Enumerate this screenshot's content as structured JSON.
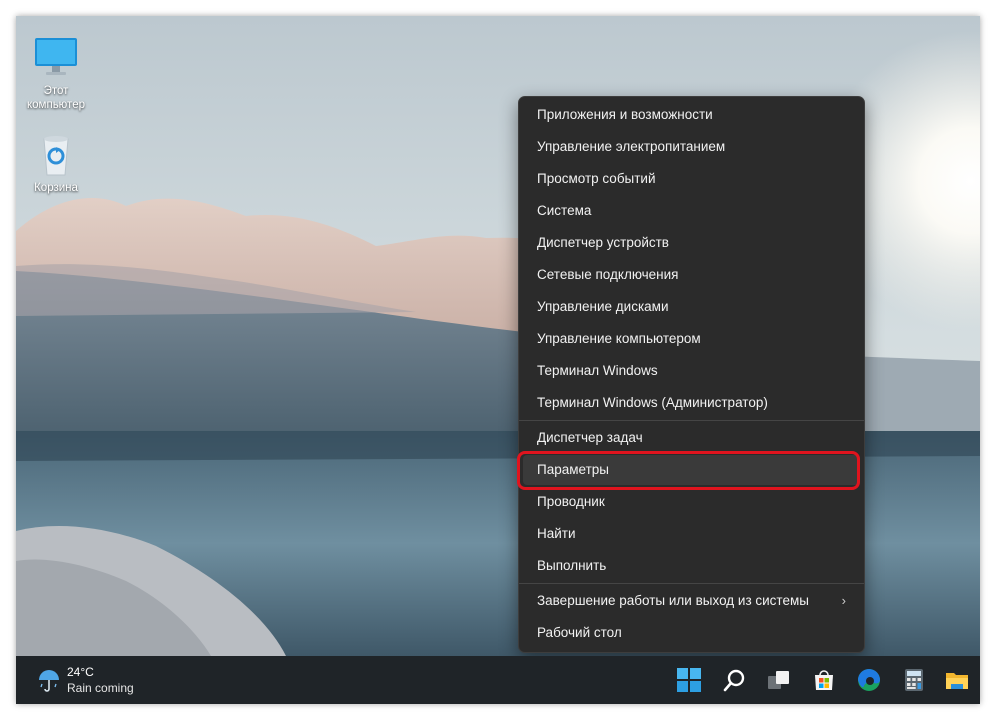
{
  "desktop": {
    "icons": [
      {
        "label": "Этот\nкомпьютер",
        "icon": "monitor-icon"
      },
      {
        "label": "Корзина",
        "icon": "recycle-bin-icon"
      }
    ]
  },
  "context_menu": {
    "items": [
      {
        "label": "Приложения и возможности"
      },
      {
        "label": "Управление электропитанием"
      },
      {
        "label": "Просмотр событий"
      },
      {
        "label": "Система"
      },
      {
        "label": "Диспетчер устройств"
      },
      {
        "label": "Сетевые подключения"
      },
      {
        "label": "Управление дисками"
      },
      {
        "label": "Управление компьютером"
      },
      {
        "label": "Терминал Windows"
      },
      {
        "label": "Терминал Windows (Администратор)"
      },
      {
        "label": "Диспетчер задач"
      },
      {
        "label": "Параметры",
        "highlighted": true
      },
      {
        "label": "Проводник"
      },
      {
        "label": "Найти"
      },
      {
        "label": "Выполнить"
      },
      {
        "label": "Завершение работы или выход из системы",
        "submenu": "chevron-right-icon"
      },
      {
        "label": "Рабочий стол"
      }
    ]
  },
  "taskbar": {
    "weather": {
      "temperature": "24°C",
      "condition": "Rain coming",
      "icon": "umbrella-rain-icon"
    },
    "apps": [
      "start-icon",
      "search-icon",
      "task-view-icon",
      "store-icon",
      "edge-icon",
      "calculator-icon",
      "file-explorer-icon"
    ]
  },
  "colors": {
    "menu_bg": "#2b2b2b",
    "highlight_outline": "#e0141e",
    "taskbar_bg": "#1f2428"
  }
}
